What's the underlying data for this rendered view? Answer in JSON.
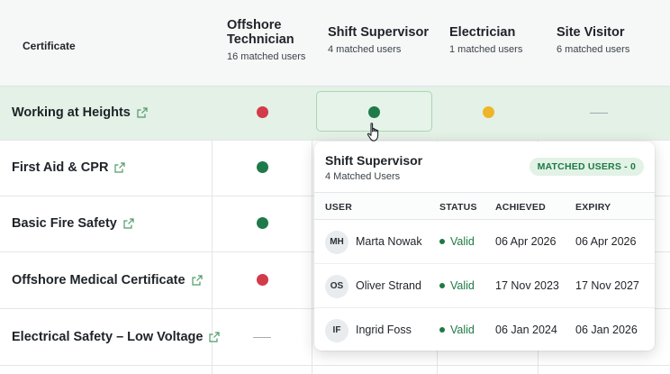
{
  "colors": {
    "green": "#1f7a4a",
    "red": "#d33a4a",
    "amber": "#f0b429",
    "highlight_row": "#e3f1e6",
    "valid": "#1d7a44"
  },
  "header": {
    "certificate_label": "Certificate",
    "columns": [
      {
        "title_line1": "Offshore",
        "title_line2": "Technician",
        "subtitle": "16 matched users"
      },
      {
        "title_line1": "Shift Supervisor",
        "title_line2": "",
        "subtitle": "4 matched users"
      },
      {
        "title_line1": "Electrician",
        "title_line2": "",
        "subtitle": "1 matched users"
      },
      {
        "title_line1": "Site Visitor",
        "title_line2": "",
        "subtitle": "6 matched users"
      }
    ]
  },
  "rows": [
    {
      "label": "Working at Heights",
      "icon": "external-link-icon",
      "cells": [
        "red",
        "green",
        "amber",
        "none"
      ]
    },
    {
      "label": "First Aid & CPR",
      "icon": "external-link-icon",
      "cells": [
        "green"
      ]
    },
    {
      "label": "Basic Fire Safety",
      "icon": "external-link-icon",
      "cells": [
        "green"
      ]
    },
    {
      "label": "Offshore Medical Certificate",
      "icon": "external-link-icon",
      "cells": [
        "red"
      ]
    },
    {
      "label": "Electrical Safety – Low Voltage",
      "icon": "external-link-icon",
      "cells": [
        "none"
      ]
    }
  ],
  "popover": {
    "title": "Shift Supervisor",
    "subtitle": "4 Matched Users",
    "badge": "MATCHED USERS - 0",
    "columns": {
      "user": "USER",
      "status": "STATUS",
      "achieved": "ACHIEVED",
      "expiry": "EXPIRY"
    },
    "users": [
      {
        "initials": "MH",
        "name": "Marta Nowak",
        "status": "Valid",
        "achieved": "06 Apr 2026",
        "expiry": "06 Apr 2026"
      },
      {
        "initials": "OS",
        "name": "Oliver Strand",
        "status": "Valid",
        "achieved": "17 Nov 2023",
        "expiry": "17 Nov 2027"
      },
      {
        "initials": "IF",
        "name": "Ingrid Foss",
        "status": "Valid",
        "achieved": "06 Jan 2024",
        "expiry": "06 Jan 2026"
      }
    ]
  }
}
